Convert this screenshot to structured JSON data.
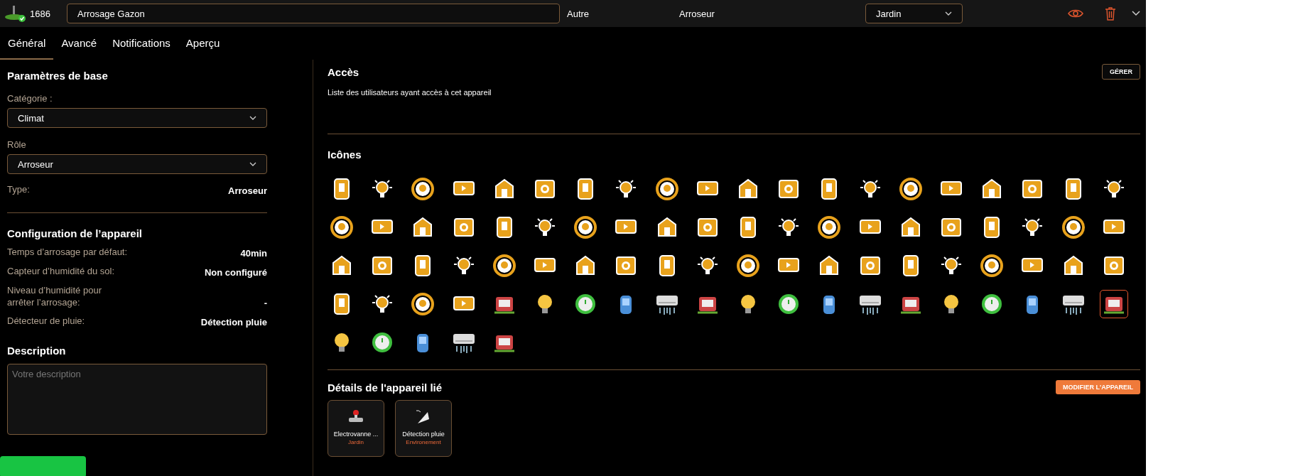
{
  "header": {
    "device_id": "1686",
    "name": "Arrosage Gazon",
    "type": "Autre",
    "role": "Arroseur",
    "room": "Jardin"
  },
  "tabs": [
    {
      "label": "Général",
      "selected": true
    },
    {
      "label": "Avancé",
      "selected": false
    },
    {
      "label": "Notifications",
      "selected": false
    },
    {
      "label": "Aperçu",
      "selected": false
    }
  ],
  "basic_settings": {
    "title": "Paramètres de base",
    "category_label": "Catégorie :",
    "category": "Climat",
    "role_label": "Rôle",
    "role": "Arroseur",
    "type_label": "Type:",
    "type": "Arroseur"
  },
  "configuration": {
    "title": "Configuration de l’appareil",
    "rows": [
      {
        "label": "Temps d’arrosage par défaut:",
        "value": "40min"
      },
      {
        "label": "Capteur d’humidité du sol:",
        "value": "Non configuré"
      },
      {
        "label": "Niveau d’humidité pour arrêter l’arrosage:",
        "value": "-"
      },
      {
        "label": "Détecteur de pluie:",
        "value": "Détection pluie"
      }
    ]
  },
  "description": {
    "title": "Description",
    "placeholder": "Votre description"
  },
  "access": {
    "title": "Accès",
    "button": "GÉRER",
    "text": "Liste des utilisateurs ayant accès à cet appareil"
  },
  "icons": {
    "title": "Icônes",
    "items": [
      {
        "kind": "flat",
        "selected": false
      },
      {
        "kind": "flat",
        "selected": false
      },
      {
        "kind": "flat",
        "selected": false
      },
      {
        "kind": "flat",
        "selected": false
      },
      {
        "kind": "flat",
        "selected": false
      },
      {
        "kind": "flat",
        "selected": false
      },
      {
        "kind": "flat",
        "selected": false
      },
      {
        "kind": "flat",
        "selected": false
      },
      {
        "kind": "flat",
        "selected": false
      },
      {
        "kind": "flat",
        "selected": false
      },
      {
        "kind": "flat",
        "selected": false
      },
      {
        "kind": "flat",
        "selected": false
      },
      {
        "kind": "flat",
        "selected": false
      },
      {
        "kind": "flat",
        "selected": false
      },
      {
        "kind": "flat",
        "selected": false
      },
      {
        "kind": "flat",
        "selected": false
      },
      {
        "kind": "flat",
        "selected": false
      },
      {
        "kind": "flat",
        "selected": false
      },
      {
        "kind": "flat",
        "selected": false
      },
      {
        "kind": "flat",
        "selected": false
      },
      {
        "kind": "flat",
        "selected": false
      },
      {
        "kind": "flat",
        "selected": false
      },
      {
        "kind": "flat",
        "selected": false
      },
      {
        "kind": "flat",
        "selected": false
      },
      {
        "kind": "flat",
        "selected": false
      },
      {
        "kind": "flat",
        "selected": false
      },
      {
        "kind": "flat",
        "selected": false
      },
      {
        "kind": "flat",
        "selected": false
      },
      {
        "kind": "flat",
        "selected": false
      },
      {
        "kind": "flat",
        "selected": false
      },
      {
        "kind": "flat",
        "selected": false
      },
      {
        "kind": "flat",
        "selected": false
      },
      {
        "kind": "flat",
        "selected": false
      },
      {
        "kind": "flat",
        "selected": false
      },
      {
        "kind": "flat",
        "selected": false
      },
      {
        "kind": "flat",
        "selected": false
      },
      {
        "kind": "flat",
        "selected": false
      },
      {
        "kind": "flat",
        "selected": false
      },
      {
        "kind": "flat",
        "selected": false
      },
      {
        "kind": "flat",
        "selected": false
      },
      {
        "kind": "flat",
        "selected": false
      },
      {
        "kind": "flat",
        "selected": false
      },
      {
        "kind": "flat",
        "selected": false
      },
      {
        "kind": "flat",
        "selected": false
      },
      {
        "kind": "flat",
        "selected": false
      },
      {
        "kind": "flat",
        "selected": false
      },
      {
        "kind": "flat",
        "selected": false
      },
      {
        "kind": "flat",
        "selected": false
      },
      {
        "kind": "flat",
        "selected": false
      },
      {
        "kind": "flat",
        "selected": false
      },
      {
        "kind": "flat",
        "selected": false
      },
      {
        "kind": "flat",
        "selected": false
      },
      {
        "kind": "flat",
        "selected": false
      },
      {
        "kind": "flat",
        "selected": false
      },
      {
        "kind": "flat",
        "selected": false
      },
      {
        "kind": "flat",
        "selected": false
      },
      {
        "kind": "flat",
        "selected": false
      },
      {
        "kind": "flat",
        "selected": false
      },
      {
        "kind": "flat",
        "selected": false
      },
      {
        "kind": "flat",
        "selected": false
      },
      {
        "kind": "flat",
        "selected": false
      },
      {
        "kind": "flat",
        "selected": false
      },
      {
        "kind": "flat",
        "selected": false
      },
      {
        "kind": "flat",
        "selected": false
      },
      {
        "kind": "photo",
        "selected": false
      },
      {
        "kind": "photo",
        "selected": false
      },
      {
        "kind": "photo",
        "selected": false
      },
      {
        "kind": "photo",
        "selected": false
      },
      {
        "kind": "photo",
        "selected": false
      },
      {
        "kind": "photo",
        "selected": false
      },
      {
        "kind": "photo",
        "selected": false
      },
      {
        "kind": "photo",
        "selected": false
      },
      {
        "kind": "photo",
        "selected": false
      },
      {
        "kind": "photo",
        "selected": false
      },
      {
        "kind": "photo",
        "selected": false
      },
      {
        "kind": "photo",
        "selected": false
      },
      {
        "kind": "photo",
        "selected": false
      },
      {
        "kind": "photo",
        "selected": false
      },
      {
        "kind": "photo",
        "selected": false
      },
      {
        "kind": "photo",
        "selected": true
      },
      {
        "kind": "photo",
        "selected": false
      },
      {
        "kind": "photo",
        "selected": false
      },
      {
        "kind": "photo",
        "selected": false
      },
      {
        "kind": "photo",
        "selected": false
      },
      {
        "kind": "photo",
        "selected": false
      }
    ]
  },
  "linked": {
    "title": "Détails de l'appareil lié",
    "button": "MODIFIER L'APPAREIL",
    "devices": [
      {
        "name": "Electrovanne ...",
        "room": "Jardin"
      },
      {
        "name": "Détection pluie",
        "room": "Environement"
      }
    ]
  }
}
